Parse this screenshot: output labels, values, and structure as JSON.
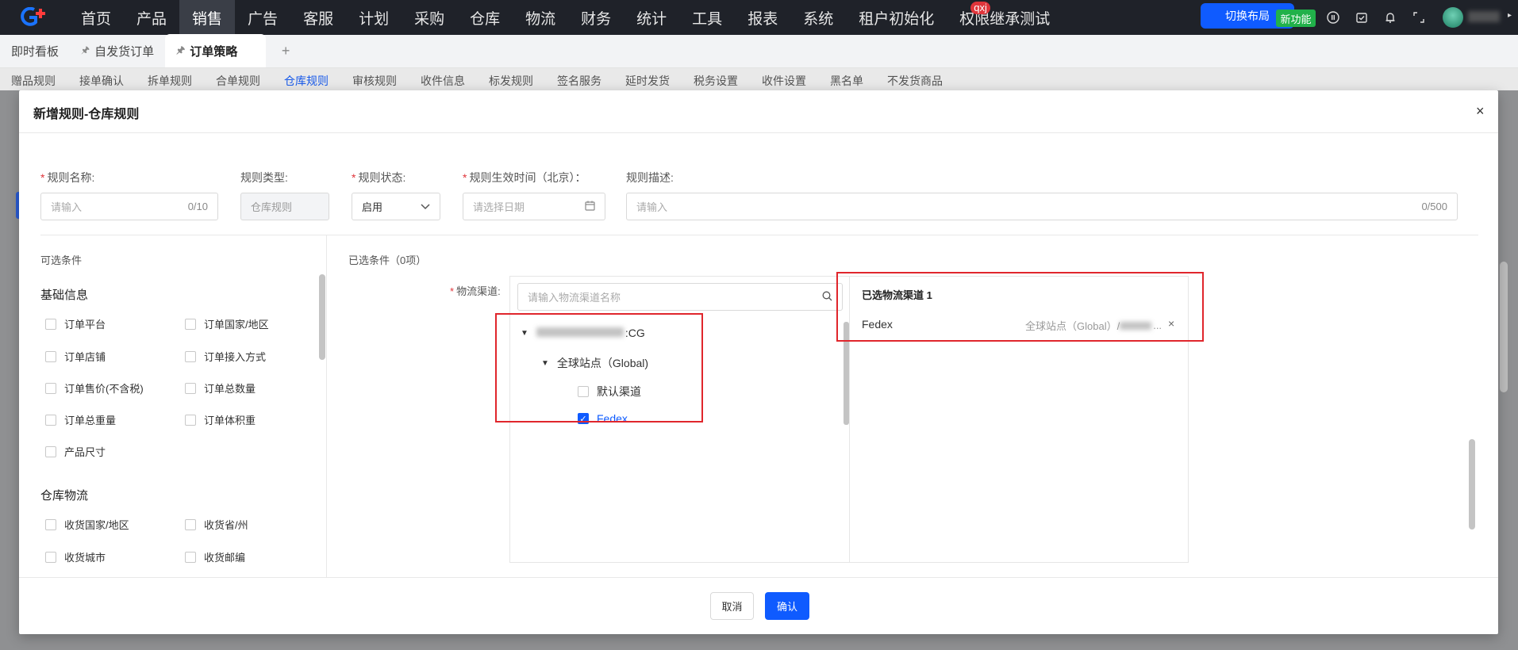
{
  "topnav": {
    "logo": "G",
    "items": [
      {
        "label": "首页"
      },
      {
        "label": "产品"
      },
      {
        "label": "销售"
      },
      {
        "label": "广告"
      },
      {
        "label": "客服"
      },
      {
        "label": "计划"
      },
      {
        "label": "采购"
      },
      {
        "label": "仓库"
      },
      {
        "label": "物流"
      },
      {
        "label": "财务"
      },
      {
        "label": "统计"
      },
      {
        "label": "工具"
      },
      {
        "label": "报表"
      },
      {
        "label": "系统"
      },
      {
        "label": "租户初始化"
      },
      {
        "label": "权限继承测试"
      }
    ],
    "badge": "qxj",
    "switch_layout": "切换布局",
    "new_feature": "新功能"
  },
  "tabs": [
    {
      "label": "即时看板"
    },
    {
      "label": "自发货订单"
    },
    {
      "label": "订单策略"
    }
  ],
  "bg_subtabs": [
    "赠品规则",
    "接单确认",
    "拆单规则",
    "合单规则",
    "仓库规则",
    "审核规则",
    "收件信息",
    "标发规则",
    "签名服务",
    "延时发货",
    "税务设置",
    "收件设置",
    "黑名单",
    "不发货商品"
  ],
  "modal": {
    "title": "新增规则-仓库规则",
    "close": "×",
    "form": {
      "name_label": "规则名称:",
      "name_placeholder": "请输入",
      "name_count": "0/10",
      "type_label": "规则类型:",
      "type_value": "仓库规则",
      "status_label": "规则状态:",
      "status_value": "启用",
      "time_label": "规则生效时间（北京）：",
      "time_placeholder": "请选择日期",
      "desc_label": "规则描述:",
      "desc_placeholder": "请输入",
      "desc_count": "0/500"
    },
    "left": {
      "title": "可选条件",
      "section1": "基础信息",
      "basic": [
        "订单平台",
        "订单国家/地区",
        "订单店铺",
        "订单接入方式",
        "订单售价(不含税)",
        "订单总数量",
        "订单总重量",
        "订单体积重",
        "产品尺寸"
      ],
      "section2": "仓库物流",
      "warehouse": [
        "收货国家/地区",
        "收货省/州",
        "收货城市",
        "收货邮编"
      ]
    },
    "right": {
      "selected_title": "已选条件（0项）",
      "channel_label": "物流渠道:",
      "search_placeholder": "请输入物流渠道名称",
      "tree": {
        "account_suffix": ":CG",
        "site": "全球站点（Global)",
        "channels": [
          {
            "label": "默认渠道",
            "checked": false
          },
          {
            "label": "Fedex",
            "checked": true
          }
        ]
      },
      "chosen_title": "已选物流渠道 1",
      "chosen_item": {
        "name": "Fedex",
        "path": "全球站点（Global）/",
        "path_suffix": "..."
      }
    },
    "footer": {
      "cancel": "取消",
      "ok": "确认"
    }
  }
}
